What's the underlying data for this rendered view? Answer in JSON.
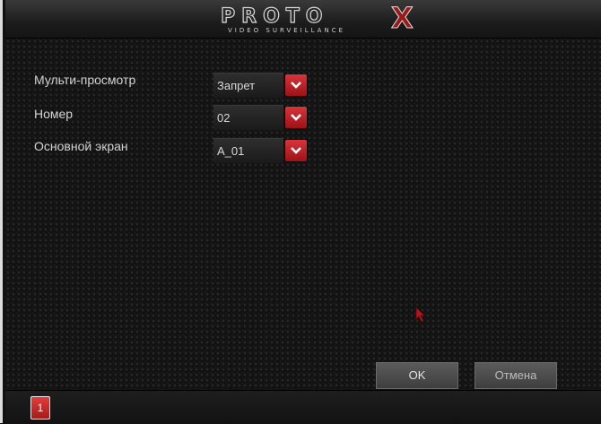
{
  "brand": {
    "logo_text": "PROTO",
    "logo_mark": "X",
    "logo_subtitle": "VIDEO SURVEILLANCE"
  },
  "form": {
    "rows": [
      {
        "label": "Мульти-просмотр",
        "value": "Запрет"
      },
      {
        "label": "Номер",
        "value": "02"
      },
      {
        "label": "Основной экран",
        "value": "A_01"
      }
    ]
  },
  "buttons": {
    "ok_label": "OK",
    "cancel_label": "Отмена"
  },
  "status_bar": {
    "alarm_badge": "1"
  },
  "icons": {
    "dropdown": "chevron-down-icon",
    "alarm": "alarm-badge-icon",
    "cursor": "mouse-pointer-icon"
  },
  "colors": {
    "accent": "#c41f26",
    "background": "#121212",
    "text": "#d2d2d2"
  }
}
